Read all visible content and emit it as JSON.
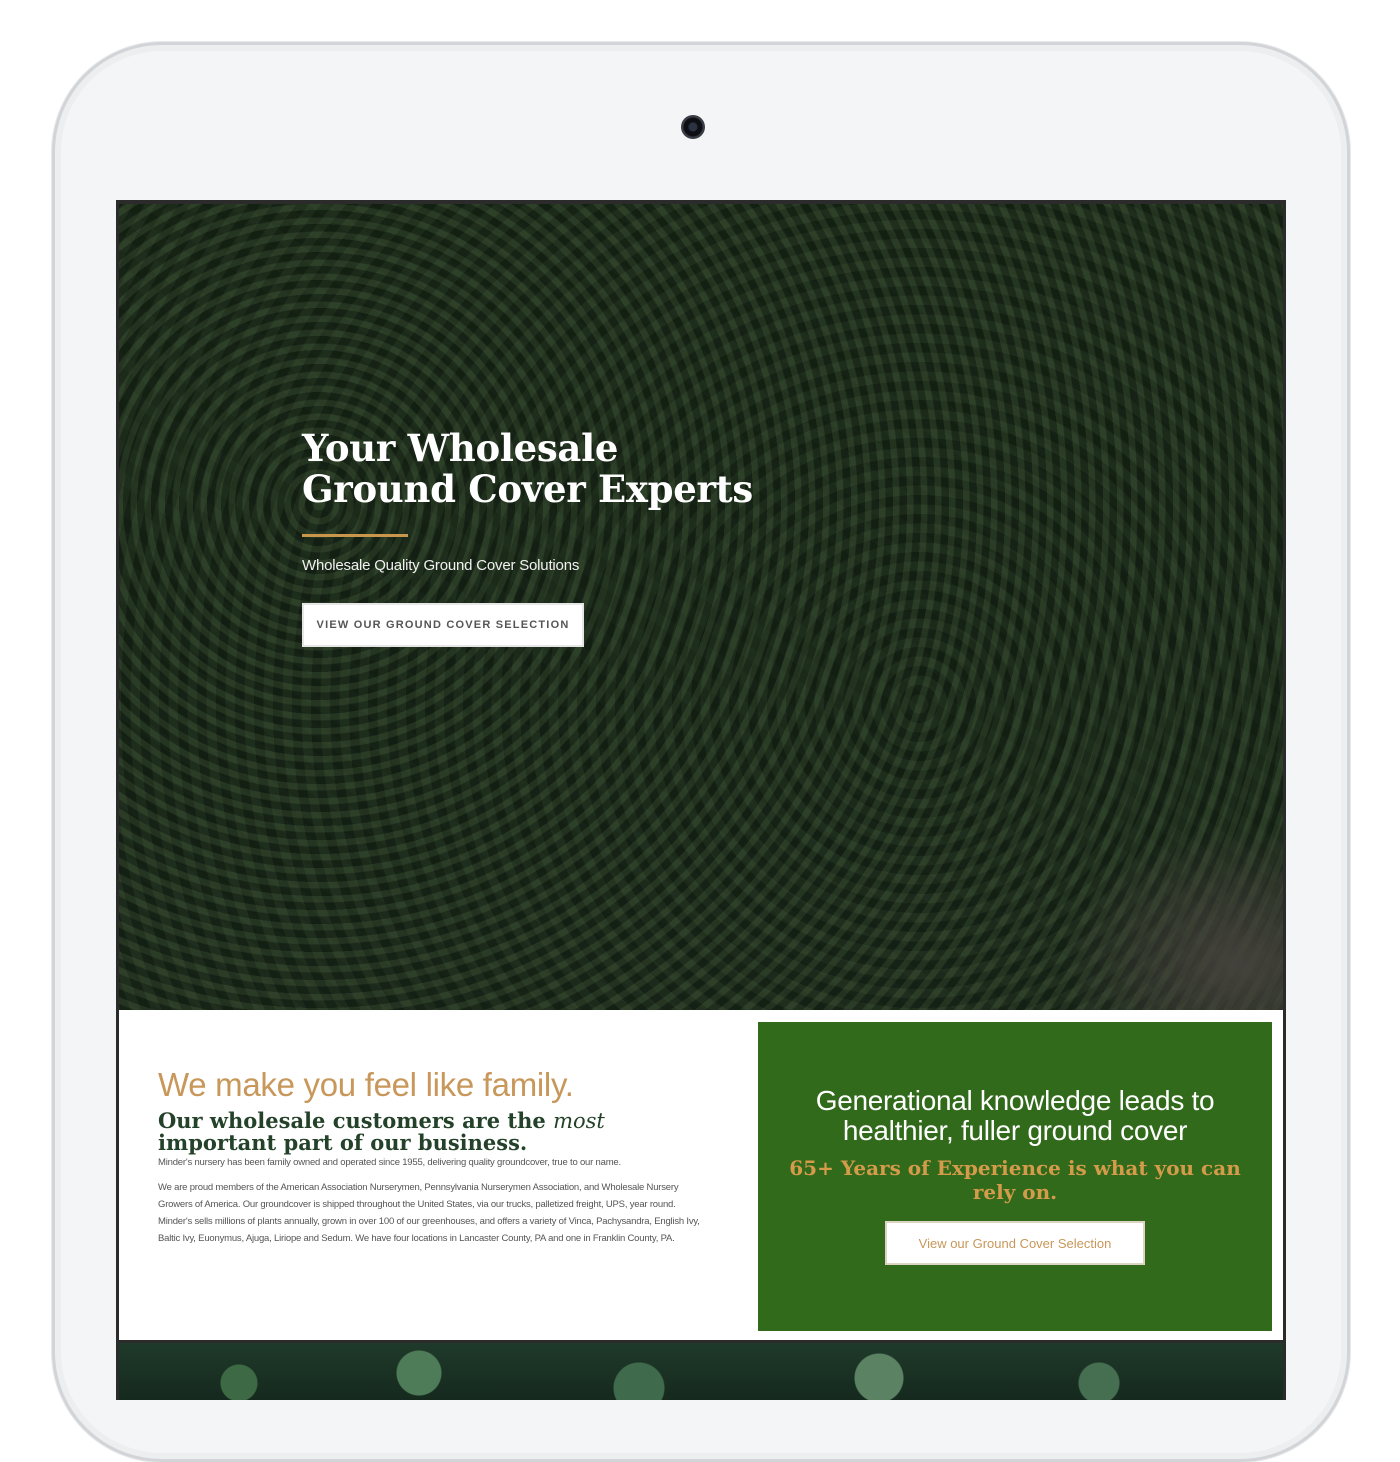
{
  "hero": {
    "title_line1": "Your Wholesale",
    "title_line2": "Ground Cover Experts",
    "subtitle": "Wholesale Quality Ground Cover Solutions",
    "button_label": "VIEW OUR GROUND COVER SELECTION"
  },
  "about": {
    "heading": "We make you feel like family.",
    "subheading_before": "Our wholesale customers are the ",
    "subheading_em": "most",
    "subheading_after": " important part of our business.",
    "paragraph1": "Minder's nursery has been family owned and operated since 1955, delivering quality groundcover, true to our name.",
    "paragraph2": "We are proud members of the American Association Nurserymen, Pennsylvania Nurserymen Association, and Wholesale Nursery Growers of America. Our groundcover is shipped throughout the United States, via our trucks, palletized freight, UPS, year round. Minder's sells millions of plants annually, grown in over 100 of our greenhouses, and offers a variety of Vinca, Pachysandra, English Ivy, Baltic Ivy, Euonymus, Ajuga, Liriope and Sedum. We have four locations in Lancaster County, PA and one in Franklin County, PA."
  },
  "promo": {
    "title": "Generational knowledge leads to healthier, fuller ground cover",
    "subtitle": "65+ Years of Experience is what you can rely on.",
    "button_label": "View our Ground Cover Selection"
  },
  "colors": {
    "accent_gold": "#c8975a",
    "brand_green": "#316a1b",
    "heading_dark_green": "#24422a"
  },
  "icons": {
    "camera": "front-camera-icon"
  }
}
